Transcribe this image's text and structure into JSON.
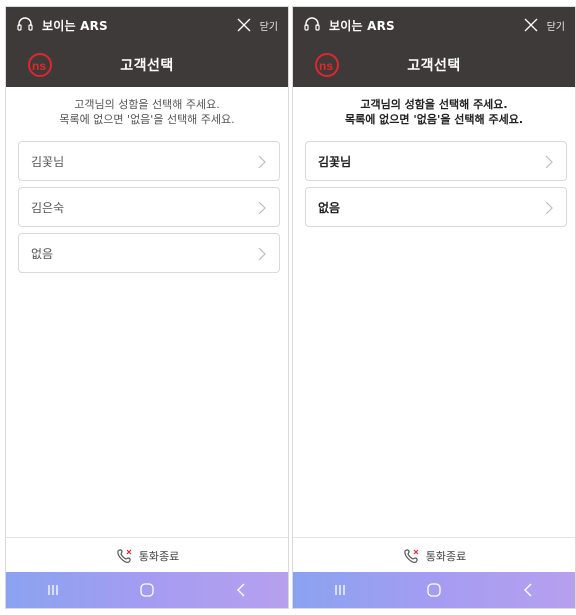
{
  "screens": [
    {
      "ars_title": "보이는 ARS",
      "close_label": "닫기",
      "nav_title": "고객선택",
      "instruction_line1": "고객님의 성함을 선택해 주세요.",
      "instruction_line2": "목록에 없으면 '없음'을 선택해 주세요.",
      "options": [
        {
          "label": "김꽃님"
        },
        {
          "label": "김은숙"
        },
        {
          "label": "없음"
        }
      ],
      "footer_label": "통화종료",
      "icons": {
        "status": "headset-icon",
        "close": "close-icon",
        "logo": "ns-logo",
        "option": "chevron-right-icon",
        "footer": "phone-hangup-icon",
        "system_nav": [
          "recent-apps-icon",
          "home-icon",
          "back-icon"
        ]
      }
    },
    {
      "ars_title": "보이는 ARS",
      "close_label": "닫기",
      "nav_title": "고객선택",
      "instruction_line1": "고객님의 성함을 선택해 주세요.",
      "instruction_line2": "목록에 없으면 '없음'을 선택해 주세요.",
      "options": [
        {
          "label": "김꽃님"
        },
        {
          "label": "없음"
        }
      ],
      "footer_label": "통화종료",
      "icons": {
        "status": "headset-icon",
        "close": "close-icon",
        "logo": "ns-logo",
        "option": "chevron-right-icon",
        "footer": "phone-hangup-icon",
        "system_nav": [
          "recent-apps-icon",
          "home-icon",
          "back-icon"
        ]
      }
    }
  ],
  "colors": {
    "header_bg": "#3e3a39",
    "logo_red": "#e1262d",
    "nav_gradient_start": "#8aa3f0",
    "nav_gradient_end": "#b7a0ee"
  }
}
